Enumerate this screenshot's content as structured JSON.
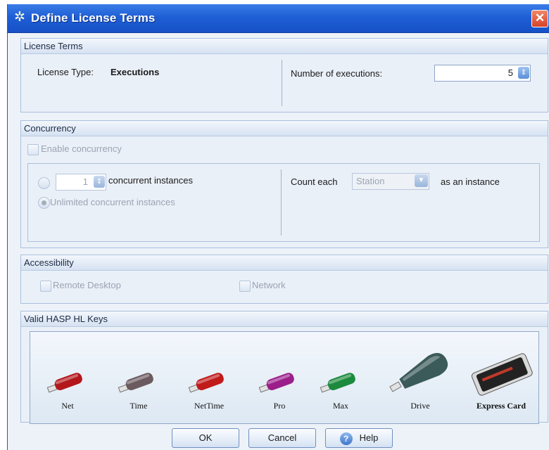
{
  "window": {
    "title": "Define License Terms",
    "close_glyph": "✕"
  },
  "license_terms": {
    "header": "License Terms",
    "license_type_label": "License Type:",
    "license_type_value": "Executions",
    "executions_label": "Number of executions:",
    "executions_value": "5"
  },
  "concurrency": {
    "header": "Concurrency",
    "enable_label": "Enable concurrency",
    "instances_value": "1",
    "instances_label": "concurrent instances",
    "unlimited_label": "Unlimited concurrent instances",
    "count_each_label": "Count each",
    "count_each_value": "Station",
    "as_instance_label": "as an instance"
  },
  "accessibility": {
    "header": "Accessibility",
    "remote_desktop_label": "Remote Desktop",
    "network_label": "Network"
  },
  "keys": {
    "header": "Valid HASP HL Keys",
    "items": [
      {
        "label": "Net",
        "color": "#b3161b"
      },
      {
        "label": "Time",
        "color": "#6b5a5e"
      },
      {
        "label": "NetTime",
        "color": "#c01a1a"
      },
      {
        "label": "Pro",
        "color": "#9b1f8a"
      },
      {
        "label": "Max",
        "color": "#1c8a3c"
      },
      {
        "label": "Drive",
        "color": "#3b5a5a"
      },
      {
        "label": "Express Card",
        "color": "#222222"
      }
    ]
  },
  "buttons": {
    "ok": "OK",
    "cancel": "Cancel",
    "help": "Help",
    "help_glyph": "?"
  },
  "icons": {
    "title": "gear-icon",
    "spinner": "spinner-arrows-icon",
    "combo": "chevron-down-icon"
  }
}
